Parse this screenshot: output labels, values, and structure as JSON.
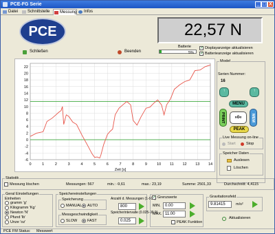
{
  "window": {
    "title": "PCE-FG Serie",
    "min": "_",
    "max": "□",
    "close": "X"
  },
  "tabs": [
    "Datei",
    "Schnittstelle",
    "Messung",
    "Infos"
  ],
  "header": {
    "logo": "PCE",
    "close_label": "Schließen",
    "end_label": "Beenden",
    "display_value": "22,57 N",
    "battery_label": "Batterie",
    "battery_pct": "5%",
    "battery_level": 0.05,
    "opt_display": "Displayanzeige aktualisieren",
    "opt_battery": "Batterieanzeige aktualisieren"
  },
  "chart_data": {
    "type": "line",
    "xlabel": "Zeit [s]",
    "xlim": [
      0,
      14
    ],
    "ylim": [
      -6,
      23
    ],
    "xticks": [
      "0",
      "1",
      "2",
      "3",
      "4",
      "5",
      "6",
      "7",
      "8",
      "9",
      "10",
      "11",
      "12",
      "13",
      "14"
    ],
    "yticks": [
      "22",
      "20",
      "18",
      "16",
      "14",
      "12",
      "10",
      "8",
      "6",
      "4",
      "2",
      "0",
      "-2",
      "-4",
      "-6"
    ],
    "reference_lines": [
      11.5,
      0
    ],
    "series": [
      {
        "x": [
          0.0,
          0.5,
          1.0,
          1.3,
          1.7,
          2.0,
          2.2,
          2.4,
          2.5,
          2.6,
          2.8,
          3.0,
          3.3,
          3.6,
          4.0,
          4.5,
          4.8,
          5.0,
          5.2,
          5.4,
          5.5,
          5.7,
          6.0,
          6.2,
          6.4,
          6.6,
          6.9,
          7.2,
          7.5,
          7.8,
          8.0,
          8.3,
          8.6,
          9.0,
          9.3,
          9.6,
          9.9,
          10.2,
          10.4,
          10.6,
          10.9,
          11.2,
          11.6,
          12.0,
          12.4,
          12.8,
          13.2,
          13.6,
          14.0
        ],
        "y": [
          1.0,
          2.0,
          2.4,
          5.5,
          6.5,
          7.5,
          8.2,
          8.8,
          10.0,
          4.6,
          7.5,
          7.0,
          5.3,
          4.6,
          1.5,
          -2.0,
          -4.2,
          -5.3,
          -5.2,
          -5.5,
          -4.5,
          -1.5,
          1.6,
          2.5,
          3.2,
          7.5,
          9.5,
          10.5,
          11.5,
          10.5,
          5.8,
          4.4,
          6.8,
          9.5,
          9.8,
          11.0,
          12.0,
          10.5,
          7.5,
          10.5,
          12.3,
          15.2,
          16.5,
          17.5,
          18.0,
          20.8,
          21.0,
          22.0,
          22.5
        ]
      }
    ]
  },
  "right": {
    "model_label": "Model",
    "serial_label": "Serien Nummer:",
    "serial_value": "16",
    "pad_menu": "MENU",
    "pad_print": "PRINT",
    "pad_mem": "MEM",
    "pad_peak": "PEAK",
    "pad_center": "»0«",
    "pad_tl": "↑",
    "pad_tr": "↑",
    "live_title": "Live Messung on-line",
    "start": "Start",
    "stop": "Stop",
    "mem_title": "Speicher Daten",
    "read": "Auslesen",
    "delete": "Löschen"
  },
  "stats": {
    "title": "Statistik",
    "clear": "Messung löschen",
    "count": "Messungen:  567",
    "min": "min.:  -9,61",
    "max": "max.:  23,19",
    "sum": "Summe:  2501,33",
    "avg": "Durchschnitt: 4,4115"
  },
  "general": {
    "title": "Geral Einstellungen",
    "units_title": "Einheiten",
    "units": [
      "gramm 'g'",
      "Kilogramm 'Kg'",
      "Newton 'N'",
      "Pfund 'lb'",
      "Unze 'oz'"
    ],
    "selected_unit": 2
  },
  "storage": {
    "title": "Speichereinstellungen",
    "save_title": "Speicherung",
    "manual": "MANUAL",
    "auto": "AUTO",
    "speed_title": "Messgeschwindigkeit",
    "slow": "SLOW",
    "fast": "FAST",
    "count_label": "Anzahl d. Messungen (1-800)",
    "count_value": "800",
    "interval_label": "Speicherintervalle (0.025-99.9)",
    "interval_value": "0.025"
  },
  "limits": {
    "title": "Grenzwerte",
    "min_label": "MIN.",
    "min_value": "0.00",
    "max_label": "MAX.",
    "max_value": "11.00",
    "peak": "PEAK Funktion"
  },
  "gravity": {
    "title": "Gravitationsfeld",
    "value": "9.81415",
    "unit": "m/s²",
    "update": "Aktualisieren"
  },
  "status": {
    "label": "PCE FM Status:",
    "value": "Messwert"
  }
}
